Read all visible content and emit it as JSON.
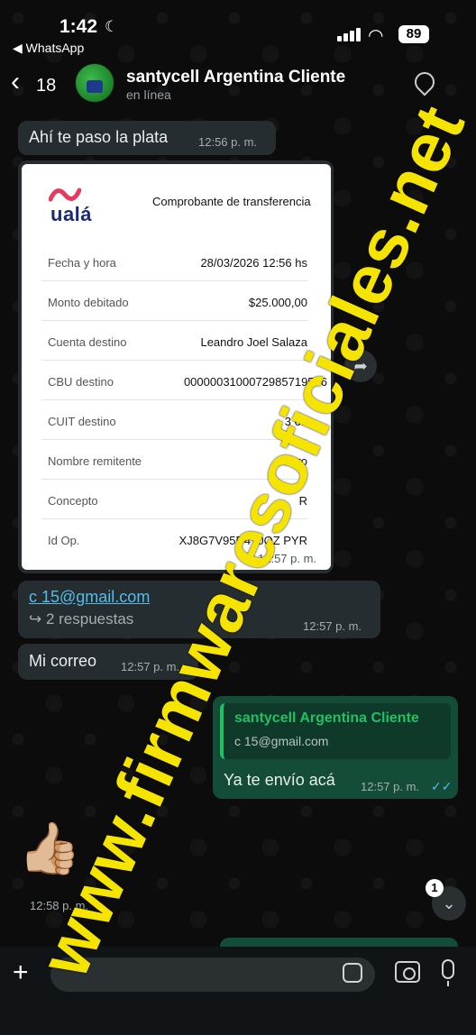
{
  "status_bar": {
    "time": "1:42",
    "back_app": "◀ WhatsApp",
    "battery": "89"
  },
  "header": {
    "back_count": "18",
    "contact_name": "santycell Argentina Cliente",
    "contact_status": "en línea"
  },
  "messages": {
    "m1": {
      "text": "Ahí te paso la plata",
      "time": "12:56 p. m."
    },
    "receipt": {
      "brand": "ualá",
      "title": "Comprobante de transferencia",
      "rows": [
        {
          "label": "Fecha y hora",
          "value": "28/03/2026 12:56 hs"
        },
        {
          "label": "Monto debitado",
          "value": "$25.000,00"
        },
        {
          "label": "Cuenta destino",
          "value": "Leandro Joel Salaza"
        },
        {
          "label": "CBU destino",
          "value": "0000003100072985719576"
        },
        {
          "label": "CUIT destino",
          "value": "3 60"
        },
        {
          "label": "Nombre remitente",
          "value": "Caro"
        },
        {
          "label": "Concepto",
          "value": "R"
        },
        {
          "label": "Id Op.",
          "value": "XJ8G7V95D470QZ PYR"
        }
      ],
      "time": "12:57 p. m."
    },
    "m3": {
      "email": "c 15@gmail.com",
      "replies": "↪ 2 respuestas",
      "time": "12:57 p. m."
    },
    "m4": {
      "text": "Mi correo",
      "time": "12:57 p. m."
    },
    "m5": {
      "quote_name": "santycell Argentina Cliente",
      "quote_text": "c 15@gmail.com",
      "text": "Ya te envío acá",
      "time": "12:57 p. m.",
      "ticks": "✓✓"
    },
    "m6": {
      "emoji": "👍🏼",
      "time": "12:58 p. m."
    }
  },
  "unread_count": "1",
  "composer": {
    "placeholder": ""
  },
  "watermark": "www.firmwaresoficiales.net",
  "colors": {
    "accent": "#21c063",
    "link": "#53bdeb",
    "watermark": "#f5e400"
  }
}
